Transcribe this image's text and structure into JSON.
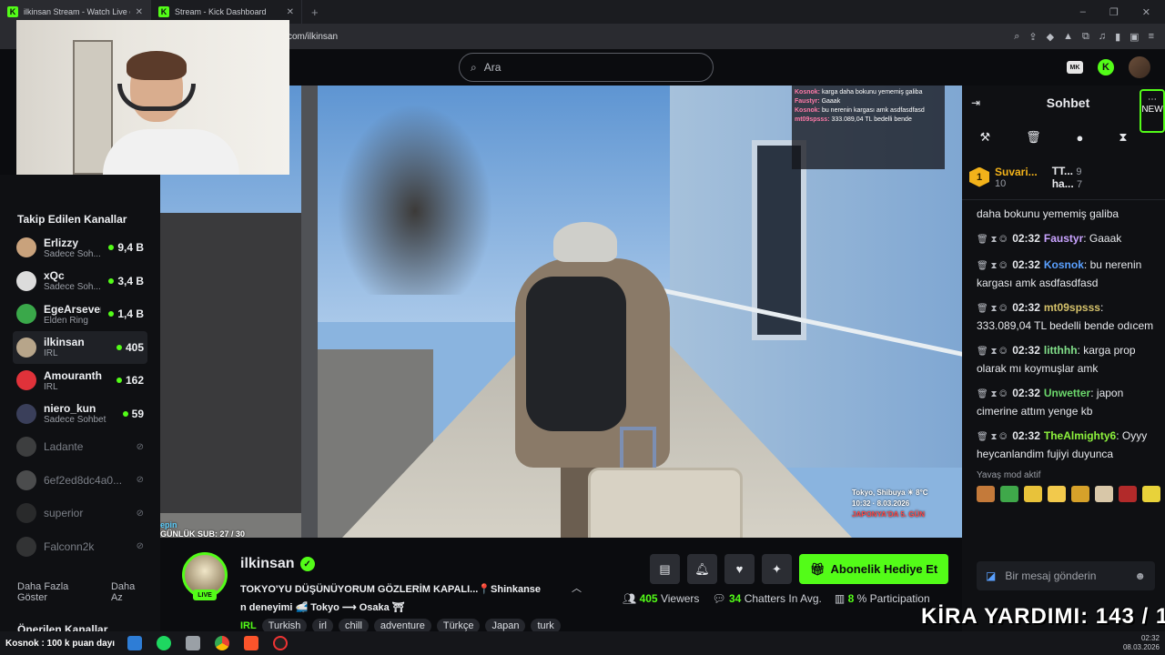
{
  "browser": {
    "tabs": [
      {
        "title": "ilkinsan Stream - Watch Live o",
        "active": true
      },
      {
        "title": "Stream - Kick Dashboard",
        "active": false
      }
    ],
    "url": "com/ilkinsan"
  },
  "header": {
    "search_placeholder": "Ara",
    "badge": "MK",
    "kick_logo": "K"
  },
  "sidebar": {
    "followed_title": "Takip Edilen Kanallar",
    "channels": [
      {
        "name": "Erlizzy",
        "sub": "Sadece Soh...",
        "viewers": "9,4 B",
        "live": true,
        "color": "#c9a27c"
      },
      {
        "name": "xQc",
        "sub": "Sadece Soh...",
        "viewers": "3,4 B",
        "live": true,
        "color": "#dcdcdc"
      },
      {
        "name": "EgeArseven",
        "sub": "Elden Ring",
        "viewers": "1,4 B",
        "live": true,
        "color": "#3aa84a"
      },
      {
        "name": "ilkinsan",
        "sub": "IRL",
        "viewers": "405",
        "live": true,
        "color": "#b7a58a"
      },
      {
        "name": "Amouranth",
        "sub": "IRL",
        "viewers": "162",
        "live": true,
        "color": "#e0323a"
      },
      {
        "name": "niero_kun",
        "sub": "Sadece Sohbet",
        "viewers": "59",
        "live": true,
        "color": "#3a3f5a"
      },
      {
        "name": "Ladante",
        "sub": "",
        "viewers": "",
        "live": false,
        "color": "#6b6b6b"
      },
      {
        "name": "6ef2ed8dc4a0...",
        "sub": "",
        "viewers": "",
        "live": false,
        "color": "#888"
      },
      {
        "name": "superior",
        "sub": "",
        "viewers": "",
        "live": false,
        "color": "#444"
      },
      {
        "name": "Falconn2k",
        "sub": "",
        "viewers": "",
        "live": false,
        "color": "#555"
      }
    ],
    "show_more": "Daha Fazla Göster",
    "show_less": "Daha Az",
    "recommended_title": "Önerilen Kanallar"
  },
  "video": {
    "overlay_chat": [
      {
        "user": "Kosnok:",
        "text": "karga daha bokunu yememiş galiba"
      },
      {
        "user": "Faustyr:",
        "text": "Gaaak"
      },
      {
        "user": "Kosnok:",
        "text": "bu nerenin kargası amk asdfasdfasd"
      },
      {
        "user": "mt09spsss:",
        "text": "333.089,04 TL bedelli bende"
      }
    ],
    "hud_location": "Tokyo, Shibuya ☀ 8°C",
    "hud_time": "10:32 · 8.03.2026",
    "hud_japan": "JAPONYA'DA 5. GÜN",
    "sub_brand": "epin",
    "sub_goal": "GÜNLÜK SUB: 27 / 30"
  },
  "stream": {
    "name": "ilkinsan",
    "live_label": "LIVE",
    "title_line1": "TOKYO'YU DÜŞÜNÜYORUM GÖZLERİM KAPALI...📍Shinkanse",
    "title_line2": "n deneyimi 🚅 Tokyo ⟶ Osaka ⛩",
    "category": "IRL",
    "tags": [
      "Turkish",
      "irl",
      "chill",
      "adventure",
      "Türkçe",
      "Japan",
      "turk"
    ],
    "gift_label": "Abonelik Hediye Et",
    "viewers": "405",
    "viewers_label": "Viewers",
    "chatters": "34",
    "chatters_label": "Chatters In Avg.",
    "participation": "8",
    "participation_label": "% Participation"
  },
  "chat": {
    "title": "Sohbet",
    "new_label": "NEW",
    "leaders": [
      {
        "rank": "1",
        "name": "Suvari...",
        "count": "10"
      },
      {
        "name": "TT...",
        "count": "9"
      },
      {
        "name": "ha...",
        "count": "7"
      }
    ],
    "messages": [
      {
        "time": "",
        "user": "",
        "text": "daha bokunu yememiş galiba",
        "ucls": ""
      },
      {
        "time": "02:32",
        "user": "Faustyr",
        "text": "Gaaak",
        "ucls": "u-fa"
      },
      {
        "time": "02:32",
        "user": "Kosnok",
        "text": "bu nerenin kargası amk asdfasdfasd",
        "ucls": "u-ko"
      },
      {
        "time": "02:32",
        "user": "mt09spsss",
        "text": "333.089,04 TL bedelli bende odıcem",
        "ucls": "u-mt"
      },
      {
        "time": "02:32",
        "user": "litthhh",
        "text": "karga prop olarak mı koymuşlar amk",
        "ucls": "u-li"
      },
      {
        "time": "02:32",
        "user": "Unwetter",
        "text": "japon cimerine attım yenge kb",
        "ucls": "u-un"
      },
      {
        "time": "02:32",
        "user": "TheAlmighty6",
        "text": "Oyyy heycanlandim fujiyi duyunca",
        "ucls": "u-th"
      }
    ],
    "slow_mode": "Yavaş mod aktif",
    "input_placeholder": "Bir mesaj gönderin",
    "kira": "KİRA YARDIMI: 143 / 145"
  },
  "taskbar": {
    "ticker": "Kosnok : 100 k puan dayı",
    "time": "02:32",
    "date": "08.03.2026"
  }
}
